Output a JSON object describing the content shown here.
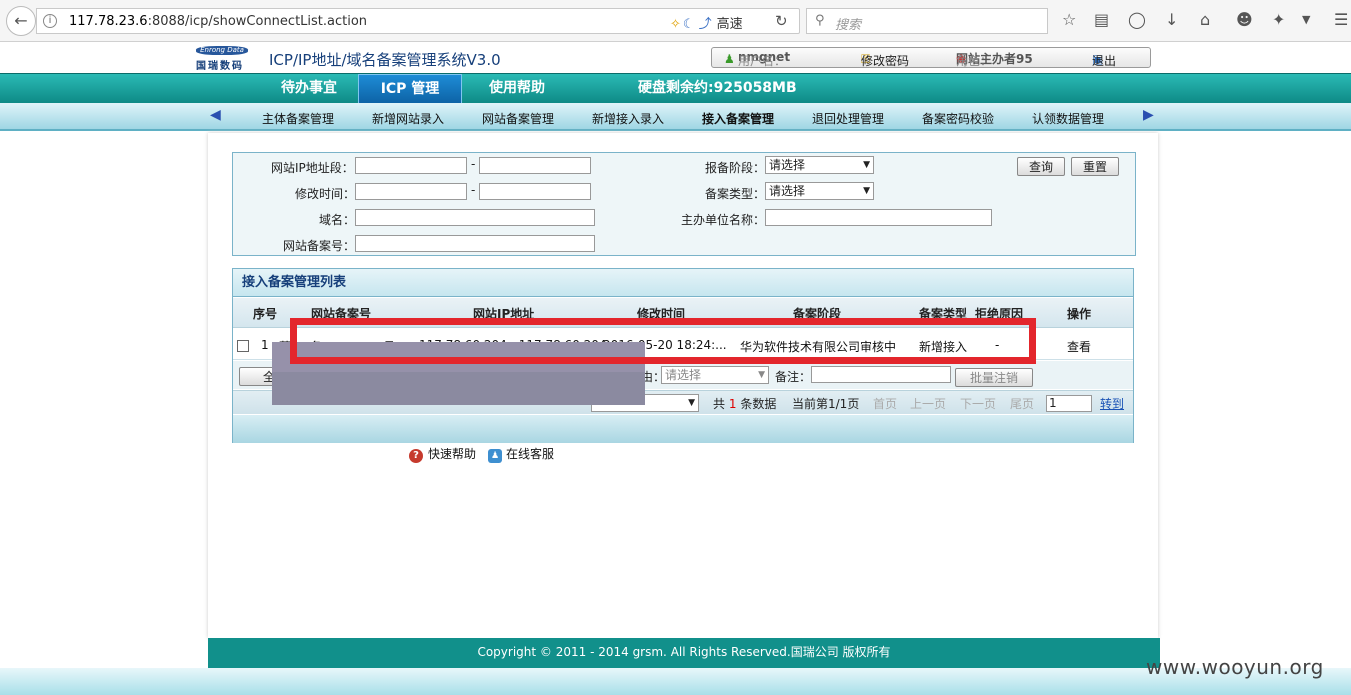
{
  "browser": {
    "url_host": "117.78.23.6",
    "url_rest": ":8088/icp/showConnectList.action",
    "ext_label": "高速",
    "search_placeholder": "搜索"
  },
  "header": {
    "logo_text_top": "Enrong Data",
    "logo_text_bottom": "国瑞数码",
    "title": "ICP/IP地址/域名备案管理系统V3.0",
    "username_label": "用户名：",
    "username": "nmgnet",
    "change_password": "修改密码",
    "role_label": "角色：",
    "role": "网站主办者95",
    "logout": "退出"
  },
  "nav": {
    "tabs": [
      "待办事宜",
      "ICP 管理",
      "使用帮助"
    ],
    "disk_info": "硬盘剩余约:925058MB"
  },
  "subnav": {
    "items": [
      "主体备案管理",
      "新增网站录入",
      "网站备案管理",
      "新增接入录入",
      "接入备案管理",
      "退回处理管理",
      "备案密码校验",
      "认领数据管理"
    ]
  },
  "form": {
    "ip_label": "网站IP地址段：",
    "modify_time_label": "修改时间：",
    "domain_label": "域名：",
    "site_record_label": "网站备案号：",
    "stage_label": "报备阶段：",
    "stage_value": "请选择",
    "type_label": "备案类型：",
    "type_value": "请选择",
    "sponsor_label": "主办单位名称：",
    "query_button": "查询",
    "reset_button": "重置",
    "dash": "-"
  },
  "list": {
    "title": "接入备案管理列表",
    "columns": [
      "序号",
      "网站备案号",
      "网站IP地址",
      "修改时间",
      "备案阶段",
      "备案类型",
      "拒绝原因",
      "操作"
    ],
    "rows": [
      {
        "index": "1",
        "record_no": "蒙ICP备11001733号-1",
        "ip": "117.78.60.204 - 117.78.60.204",
        "time": "2016-05-20 18:24:...",
        "stage": "华为软件技术有限公司审核中",
        "type": "新增接入",
        "reason": "-",
        "action": "查看"
      }
    ],
    "select_all": "全",
    "cancel_reason_suffix": "由：",
    "cancel_reason_value": "请选择",
    "remark_label": "备注：",
    "batch_cancel": "批量注销",
    "pager": {
      "total_prefix": "共",
      "total_count": "1",
      "total_suffix": "条数据",
      "current": "当前第1/1页",
      "first": "首页",
      "prev": "上一页",
      "next": "下一页",
      "last": "尾页",
      "page_input": "1",
      "goto": "转到"
    }
  },
  "help": {
    "quick_help": "快速帮助",
    "online_service": "在线客服"
  },
  "footer": {
    "copyright": "Copyright © 2011 - 2014 grsm. All Rights Reserved.国瑞公司 版权所有"
  },
  "watermark": "www.wooyun.org"
}
